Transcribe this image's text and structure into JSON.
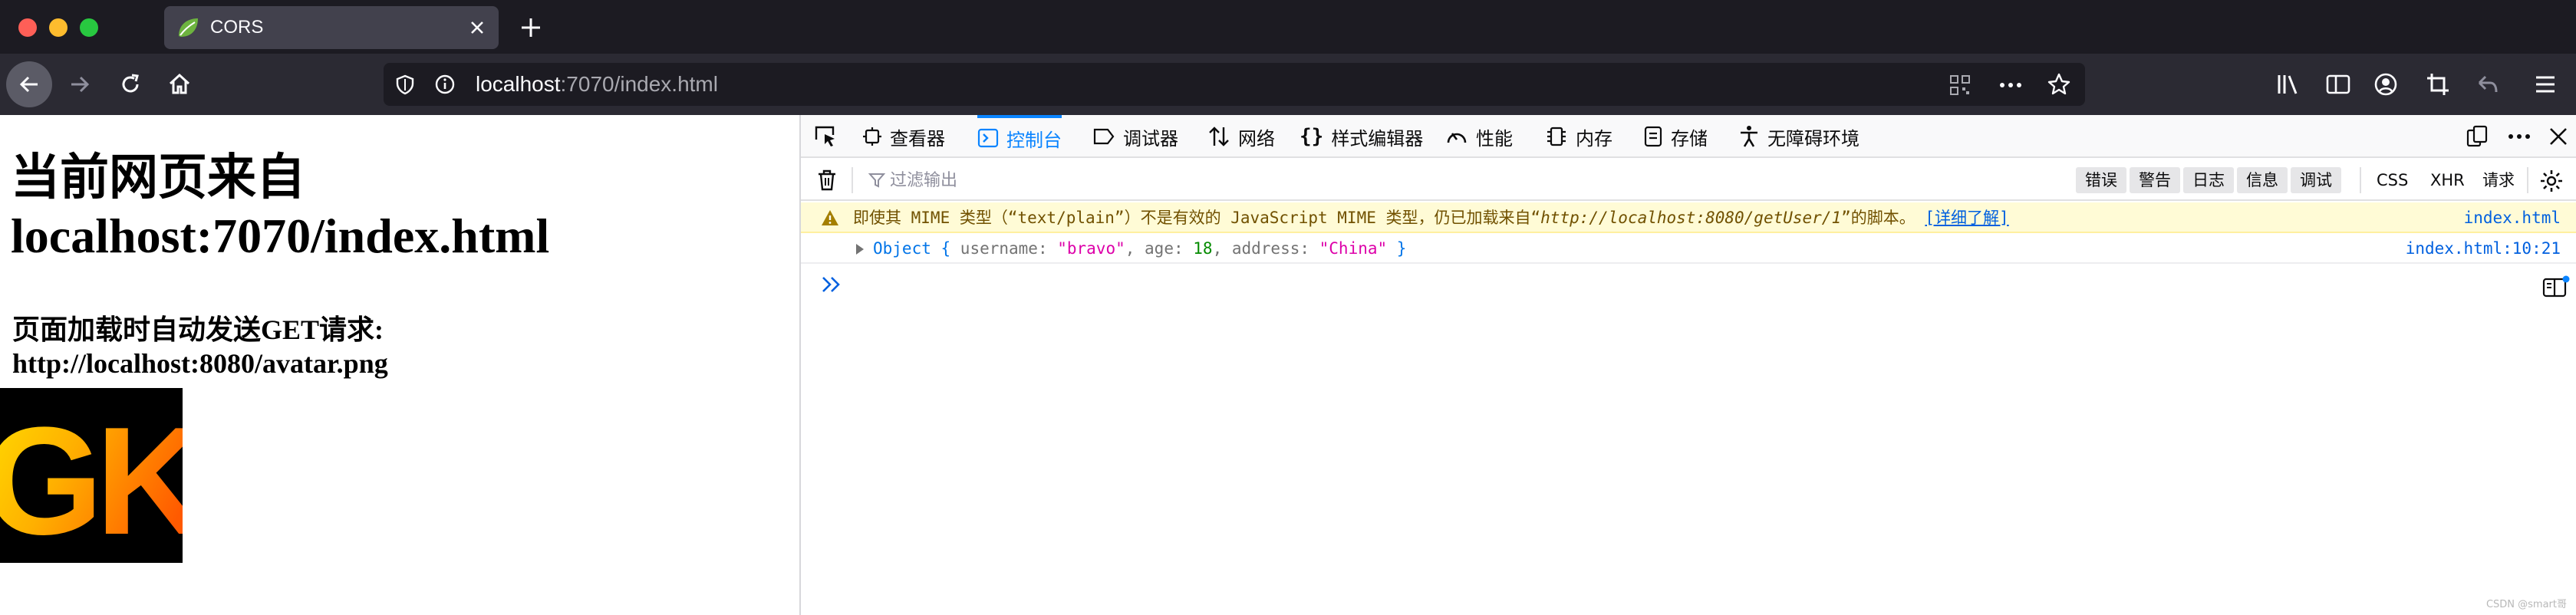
{
  "browser": {
    "tab": {
      "title": "CORS",
      "favicon": "spring-leaf-icon"
    },
    "url": {
      "host": "localhost",
      "rest": ":7070/index.html"
    }
  },
  "page": {
    "heading": "当前网页来自localhost:7070/index.html",
    "subheading": "页面加载时自动发送GET请求: http://localhost:8080/avatar.png",
    "avatar_text": "GK"
  },
  "devtools": {
    "tabs": [
      {
        "label": "查看器",
        "icon": "inspector-icon"
      },
      {
        "label": "控制台",
        "icon": "console-icon"
      },
      {
        "label": "调试器",
        "icon": "debugger-icon"
      },
      {
        "label": "网络",
        "icon": "network-icon"
      },
      {
        "label": "样式编辑器",
        "icon": "style-editor-icon"
      },
      {
        "label": "性能",
        "icon": "performance-icon"
      },
      {
        "label": "内存",
        "icon": "memory-icon"
      },
      {
        "label": "存储",
        "icon": "storage-icon"
      },
      {
        "label": "无障碍环境",
        "icon": "accessibility-icon"
      }
    ],
    "active_tab": "控制台",
    "filter": {
      "placeholder": "过滤输出",
      "levels": [
        "错误",
        "警告",
        "日志",
        "信息",
        "调试"
      ],
      "types": [
        "CSS",
        "XHR",
        "请求"
      ]
    },
    "messages": {
      "warning": {
        "prefix": "即使其 MIME 类型（“text/plain”）不是有效的 JavaScript MIME 类型，仍已加载来自“",
        "url": "http://localhost:8080/getUser/1",
        "suffix": "”的脚本。",
        "link": "[详细了解]",
        "source": "index.html"
      },
      "log": {
        "object_label": "Object { ",
        "k1": "username: ",
        "v1": "\"bravo\"",
        "k2": ", age: ",
        "v2": "18",
        "k3": ", address: ",
        "v3": "\"China\"",
        "close": " }",
        "source": "index.html:10:21"
      }
    },
    "prompt": "»"
  },
  "watermark": "CSDN @smart哥",
  "colors": {
    "accent": "#0a84ff",
    "warning_bg": "#fffbd6",
    "chrome_dark": "#1c1b22"
  }
}
